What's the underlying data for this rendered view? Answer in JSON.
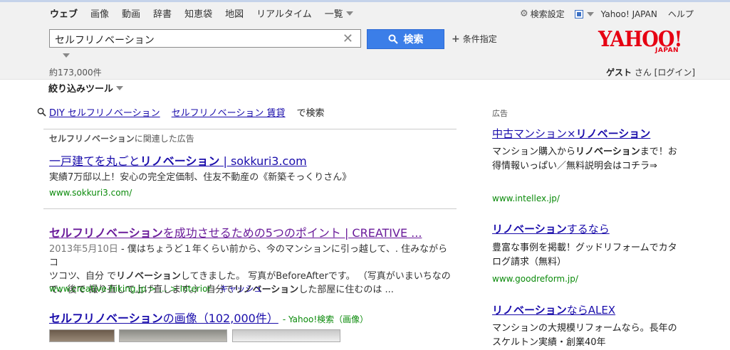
{
  "nav": {
    "tabs": [
      "ウェブ",
      "画像",
      "動画",
      "辞書",
      "知恵袋",
      "地図",
      "リアルタイム"
    ],
    "more_label": "一覧"
  },
  "top_links": {
    "settings": "検索設定",
    "yahoo_japan": "Yahoo! JAPAN",
    "help": "ヘルプ"
  },
  "search": {
    "query": "セルフリノベーション",
    "button_label": "検索",
    "conditions_label": "条件指定"
  },
  "logo": {
    "main": "YAHOO!",
    "sub": "JAPAN"
  },
  "result_count": "約173,000件",
  "user": {
    "guest": "ゲスト",
    "san": " さん [",
    "login": "ログイン",
    "close": "]"
  },
  "tools_label": "絞り込みツール",
  "related": {
    "items": [
      "DIY セルフリノベーション",
      "セルフリノベーション 賃貸"
    ],
    "suffix": "で検索"
  },
  "ad_section": {
    "label_bold": "セルフリノベーション",
    "label_rest": "に関連した広告"
  },
  "ad1": {
    "title_pre": "一戸建てを丸ごと",
    "title_bold": "リノベーション",
    "title_post": " | sokkuri3.com",
    "desc": "実績7万邸以上！安心の完全定価制、住友不動産の《新築そっくりさん》",
    "url": "www.sokkuri3.com/"
  },
  "result1": {
    "title_bold": "セルフリノベーション",
    "title_post": "を成功させるための5つのポイント | CREATIVE ...",
    "date": "2013年5月10日",
    "desc_line1": " - 僕はちょうど１年くらい前から、今のマンションに引っ越して、. 住みながらコ",
    "desc_line2_pre": "ツコツ、自分 で",
    "desc_line2_bold": "リノベーション",
    "desc_line2_post": "してきました。 写真がBeforeAfterです。 （写真がいまいちなの",
    "desc_line3": "で、後で 撮り直して上げ直します。） 自分で",
    "desc_line3_bold": "リノベーション",
    "desc_line3_post": "した部屋に住むのは ...",
    "url": "www.creative-hiking.jp > … > Interior",
    "cache": "キャッシュ"
  },
  "images": {
    "title_bold": "セルフリノベーション",
    "title_post": "の画像（102,000件）",
    "source": "- Yahoo!検索（画像）"
  },
  "sidebar": {
    "label": "広告",
    "ads": [
      {
        "title_pre": "中古マンション×",
        "title_bold": "リノベーション",
        "title_post": "",
        "desc_pre": "マンション購入から",
        "desc_bold": "リノベーション",
        "desc_post": "まで！お得情報いっぱい／無料説明会はコチラ⇒",
        "url": "www.intellex.jp/"
      },
      {
        "title_pre": "",
        "title_bold": "リノベーション",
        "title_post": "するなら",
        "desc_pre": "豊富な事例を掲載！グッドリフォームでカタログ請求（無料）",
        "desc_bold": "",
        "desc_post": "",
        "url": "www.goodreform.jp/"
      },
      {
        "title_pre": "",
        "title_bold": "リノベーション",
        "title_post": "ならALEX",
        "desc_pre": "マンションの大規模リフォームなら。長年のスケルトン実績・創業40年",
        "desc_bold": "",
        "desc_post": "",
        "url": ""
      }
    ]
  }
}
